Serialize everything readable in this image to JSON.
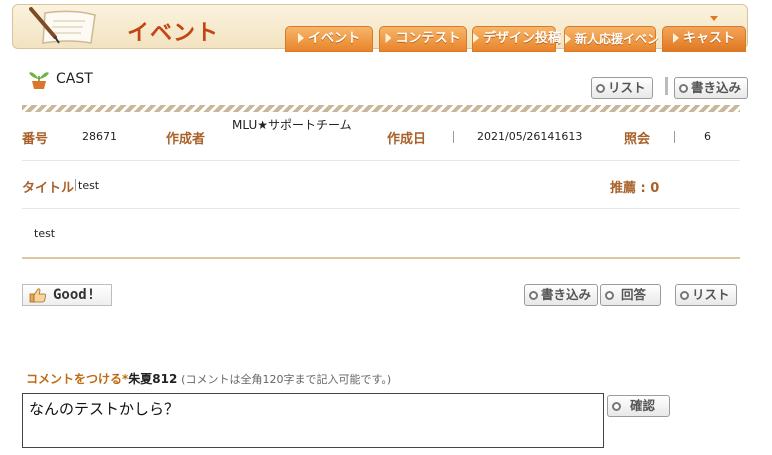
{
  "header": {
    "title": "イベント",
    "tabs": [
      {
        "label": "イベント"
      },
      {
        "label": "コンテスト"
      },
      {
        "label": "デザイン投稿"
      },
      {
        "label": "新人応援イベント"
      },
      {
        "label": "キャスト"
      }
    ]
  },
  "board": {
    "name": "CAST",
    "top_buttons": {
      "list": "リスト",
      "write": "書き込み"
    }
  },
  "post": {
    "number_label": "番号",
    "number": "28671",
    "author_label": "作成者",
    "author": "MLU★サポートチーム",
    "date_label": "作成日",
    "date": "2021/05/26141613",
    "views_label": "照会",
    "views": "6",
    "title_label": "タイトル",
    "title": "test",
    "recommend": "推薦 : 0",
    "body": "test"
  },
  "actions": {
    "good": "Good!",
    "write": "書き込み",
    "reply": "回答",
    "list": "リスト"
  },
  "comment": {
    "prompt": "コメントをつける*",
    "user": "朱夏812",
    "note": "(コメントは全角120字まで記入可能です。)",
    "value": "なんのテストかしら？",
    "confirm": "確認"
  },
  "colors": {
    "accent": "#e8842a",
    "label": "#a8612a",
    "title": "#c44514"
  }
}
